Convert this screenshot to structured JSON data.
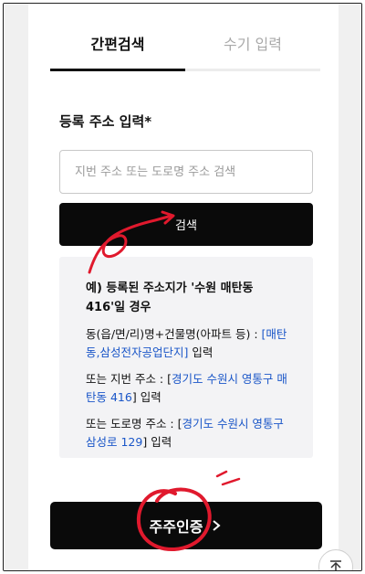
{
  "tabs": {
    "simple": "간편검색",
    "manual": "수기 입력"
  },
  "address": {
    "label": "등록 주소 입력*",
    "placeholder": "지번 주소 또는 도로명 주소 검색",
    "search_button": "검색"
  },
  "info": {
    "title": "예) 등록된 주소지가 '수원 매탄동 416'일 경우",
    "p1_prefix": "동(읍/면/리)명+건물명(아파트 등) : ",
    "p1_link": "[매탄동,삼성전자공업단지]",
    "p1_suffix": " 입력",
    "p2_prefix": "또는 지번 주소 : [",
    "p2_link": "경기도 수원시 영통구 매탄동 416",
    "p2_suffix": "] 입력",
    "p3_prefix": "또는 도로명 주소 : [",
    "p3_link": "경기도 수원시 영통구 삼성로 129",
    "p3_suffix": "] 입력"
  },
  "auth": {
    "button": "주주인증"
  },
  "icons": {
    "chevron": "chevron-right-icon",
    "top": "arrow-up-to-top-icon"
  },
  "colors": {
    "link": "#1a56c8",
    "button_bg": "#0a0a0a",
    "info_bg": "#f3f3f5",
    "annotation": "#e0192d"
  }
}
